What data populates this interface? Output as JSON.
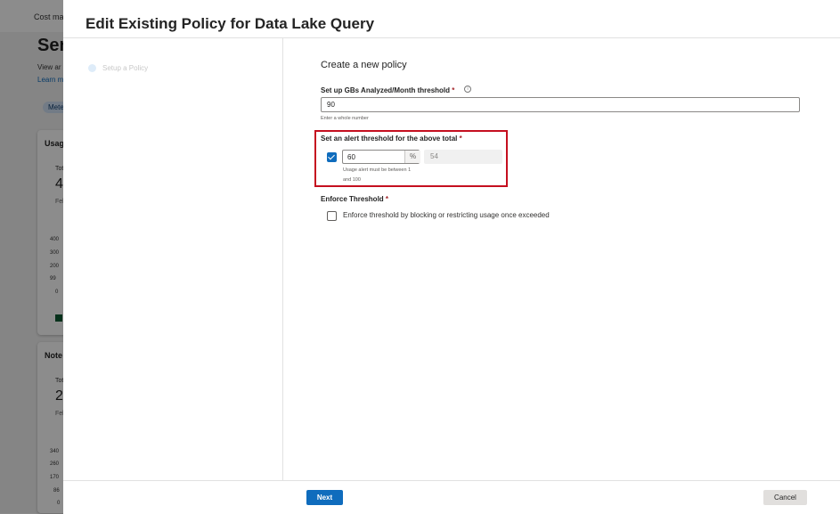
{
  "background": {
    "breadcrumb": "Cost mar",
    "title": "Ser",
    "view_text": "View ar",
    "learn_link": "Learn m",
    "pill": "Mete",
    "card1": {
      "title": "Usag",
      "sub": "Tot",
      "big": "4",
      "feb": "Feb",
      "ticks": [
        "400",
        "300",
        "200",
        "99",
        "0"
      ]
    },
    "card2": {
      "title": "Note",
      "sub": "Tot",
      "big": "2",
      "feb": "Feb",
      "ticks": [
        "340",
        "260",
        "170",
        "86",
        "0"
      ]
    }
  },
  "panel": {
    "title": "Edit Existing Policy for Data Lake Query",
    "steps": [
      {
        "label": "Setup a Policy"
      }
    ],
    "section_title": "Create a new policy",
    "gb_field": {
      "label": "Set up GBs Analyzed/Month threshold",
      "required_mark": "*",
      "value": "90",
      "hint": "Enter a whole number",
      "info_icon": "i"
    },
    "alert_field": {
      "label": "Set an alert threshold for the above total",
      "required_mark": "*",
      "checked": true,
      "percent_value": "60",
      "percent_symbol": "%",
      "computed_value": "54",
      "hint_line1": "Usage alert must be between 1",
      "hint_line2": "and 100"
    },
    "enforce_field": {
      "label": "Enforce Threshold",
      "required_mark": "*",
      "checked": false,
      "checkbox_label": "Enforce threshold by blocking or restricting usage once exceeded"
    },
    "footer": {
      "next_label": "Next",
      "cancel_label": "Cancel"
    }
  },
  "colors": {
    "accent": "#0f6cbd",
    "highlight_border": "#c50f1f",
    "required": "#a4262c"
  }
}
